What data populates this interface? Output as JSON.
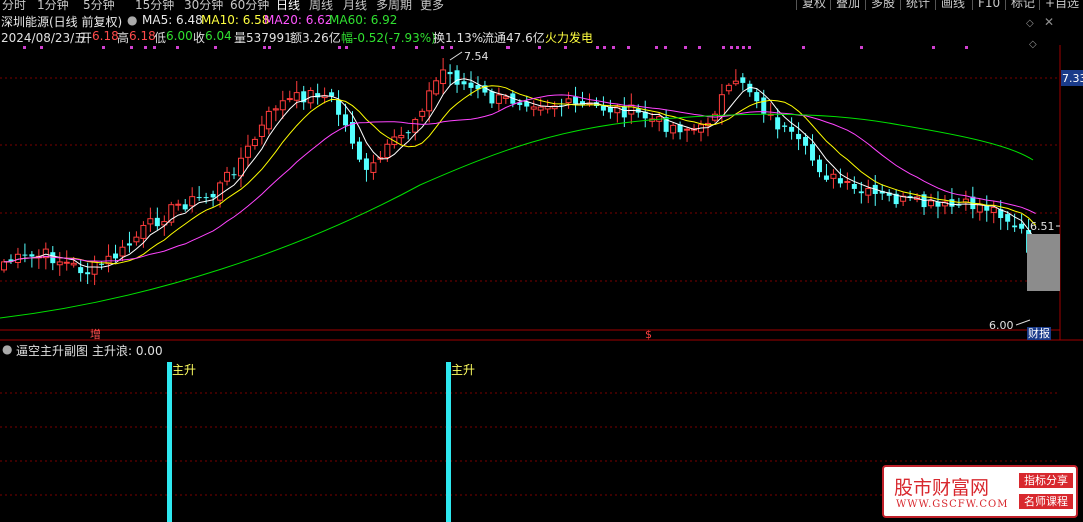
{
  "toolbar": {
    "periods": [
      "分时",
      "1分钟",
      "5分钟",
      "15分钟",
      "30分钟",
      "60分钟",
      "日线",
      "周线",
      "月线",
      "多周期",
      "更多"
    ],
    "active_period": "日线",
    "right_buttons": [
      "复权",
      "叠加",
      "多股",
      "统计",
      "画线",
      "F10",
      "标记",
      "+自选"
    ]
  },
  "header": {
    "stock_name": "深圳能源(日线 前复权)",
    "ma5": "MA5: 6.48",
    "ma10": "MA10: 6.58",
    "ma20": "MA20: 6.62",
    "ma60": "MA60: 6.92"
  },
  "info": {
    "date": "2024/08/23/五",
    "open_label": "开",
    "open": "6.18",
    "high_label": "高",
    "high": "6.18",
    "low_label": "低",
    "low": "6.00",
    "close_label": "收",
    "close": "6.04",
    "volume": "量537991",
    "amount": "额3.26亿",
    "change": "幅-0.52(-7.93%)",
    "turnover": "换1.13%",
    "float_cap": "流通47.6亿",
    "concept": "火力发电"
  },
  "main_chart": {
    "price_high_label": "7.54",
    "price_low_label": "6.00",
    "axis_right_top": "7.33",
    "axis_right_mid": "6.51",
    "marker_increase": "增",
    "marker_dollar": "$",
    "marker_report": "财报"
  },
  "sub_chart": {
    "title": "逼空主升副图",
    "value_label": "主升浪: 0.00",
    "signal_label": "主升"
  },
  "watermark": {
    "brand": "股市财富网",
    "url": "WWW.GSCFW.COM",
    "tag1": "指标分享",
    "tag2": "名师课程"
  },
  "colors": {
    "up": "#ff3c3c",
    "down": "#54ffff",
    "ma5": "#ffffff",
    "ma10": "#ffff00",
    "ma20": "#ff44ff",
    "ma60": "#00e000",
    "grid": "#8b0000"
  }
}
